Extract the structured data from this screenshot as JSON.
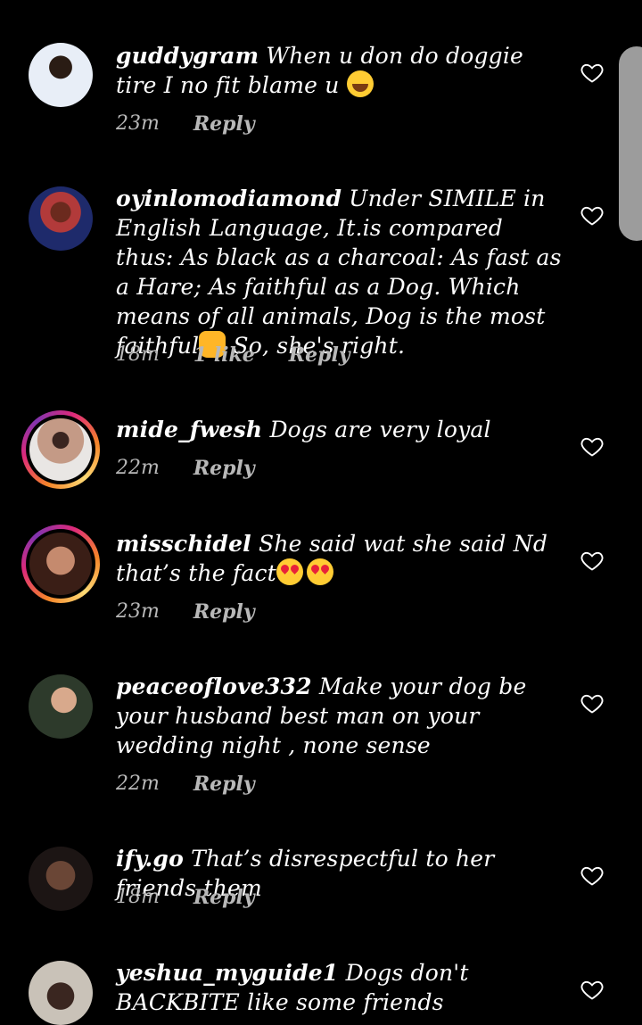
{
  "comments": [
    {
      "username": "guddygram",
      "text": "When u don do doggie tire I no fit blame u",
      "emoji": "laugh",
      "time": "23m",
      "likes": "",
      "reply": "Reply",
      "avatar_ring": false,
      "avatar_color": "#2f6fd6"
    },
    {
      "username": "oyinlomodiamond",
      "text": "Under SIMILE in English Language, It.is compared thus: As black as a charcoal: As fast as a Hare; As faithful as a Dog. Which means of all animals, Dog is the most faithful",
      "emoji_mid": "hands",
      "text_after": " So, she's right.",
      "time": "18m",
      "likes": "1 like",
      "reply": "Reply",
      "avatar_ring": false,
      "avatar_color": "#1e2a6b"
    },
    {
      "username": "mide_fwesh",
      "text": "Dogs are very loyal",
      "time": "22m",
      "likes": "",
      "reply": "Reply",
      "avatar_ring": true,
      "avatar_color": "#b89e8e"
    },
    {
      "username": "misschidel",
      "text": "She said wat she said Nd that’s the fact",
      "emoji_double": "heart-eyes",
      "time": "23m",
      "likes": "",
      "reply": "Reply",
      "avatar_ring": true,
      "avatar_color": "#8a4b3a"
    },
    {
      "username": "peaceoflove332",
      "text": "Make your dog be your husband best man on your wedding night , none sense",
      "time": "22m",
      "likes": "",
      "reply": "Reply",
      "avatar_ring": false,
      "avatar_color": "#5a6f55"
    },
    {
      "username": "ify.go",
      "text": "That’s disrespectful to her friends them",
      "time": "18m",
      "likes": "",
      "reply": "Reply",
      "avatar_ring": false,
      "avatar_color": "#3a2a28"
    },
    {
      "username": "yeshua_myguide1",
      "text": "Dogs don't BACKBITE like some friends",
      "time": "",
      "likes": "",
      "reply": "",
      "avatar_ring": false,
      "avatar_color": "#c9c2b8"
    }
  ]
}
